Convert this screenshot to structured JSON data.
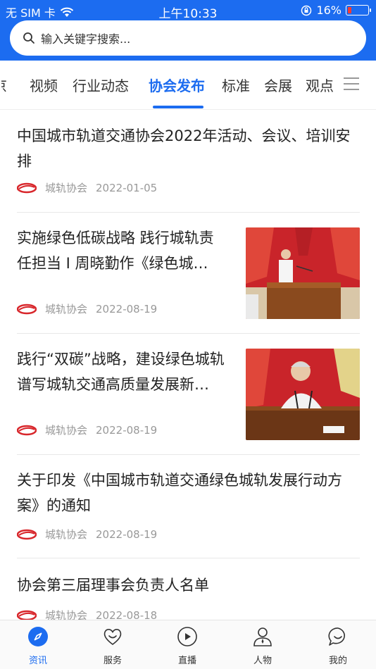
{
  "status_bar": {
    "carrier": "无 SIM 卡",
    "time": "上午10:33",
    "battery": "16%",
    "battery_level": 0.16
  },
  "search": {
    "placeholder": "输入关键字搜索..."
  },
  "tabs": [
    {
      "label": "京"
    },
    {
      "label": "视频"
    },
    {
      "label": "行业动态"
    },
    {
      "label": "协会发布",
      "active": true
    },
    {
      "label": "标准"
    },
    {
      "label": "会展"
    },
    {
      "label": "观点"
    }
  ],
  "articles": [
    {
      "title": "中国城市轨道交通协会2022年活动、会议、培训安排",
      "source": "城轨协会",
      "date": "2022-01-05"
    },
    {
      "title_line1": "实施绿色低碳战略 践行城轨责",
      "title_line2": "任担当 I 周晓勤作《绿色城…",
      "source": "城轨协会",
      "date": "2022-08-19",
      "has_image": true
    },
    {
      "title_line1": "践行“双碳”战略，建设绿色城轨",
      "title_line2": "谱写城轨交通高质量发展新…",
      "source": "城轨协会",
      "date": "2022-08-19",
      "has_image": true
    },
    {
      "title": "关于印发《中国城市轨道交通绿色城轨发展行动方案》的通知",
      "source": "城轨协会",
      "date": "2022-08-19"
    },
    {
      "title": "协会第三届理事会负责人名单",
      "source": "城轨协会",
      "date": "2022-08-18"
    }
  ],
  "bottom_nav": [
    {
      "label": "资讯",
      "icon": "compass-icon",
      "active": true
    },
    {
      "label": "服务",
      "icon": "heart-icon"
    },
    {
      "label": "直播",
      "icon": "play-icon"
    },
    {
      "label": "人物",
      "icon": "person-icon"
    },
    {
      "label": "我的",
      "icon": "chat-icon"
    }
  ],
  "colors": {
    "primary": "#1c6cf0",
    "logo_red": "#d8262b"
  }
}
